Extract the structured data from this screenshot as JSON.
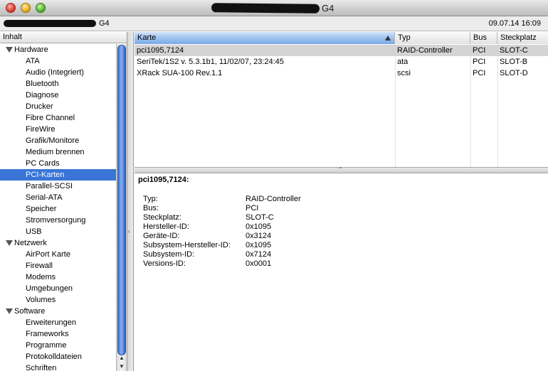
{
  "window": {
    "title_suffix": "G4"
  },
  "infobar": {
    "model": "G4",
    "datetime": "09.07.14 16:09"
  },
  "sidebar": {
    "header": "Inhalt",
    "groups": [
      {
        "label": "Hardware",
        "items": [
          "ATA",
          "Audio (Integriert)",
          "Bluetooth",
          "Diagnose",
          "Drucker",
          "Fibre Channel",
          "FireWire",
          "Grafik/Monitore",
          "Medium brennen",
          "PC Cards",
          "PCI-Karten",
          "Parallel-SCSI",
          "Serial-ATA",
          "Speicher",
          "Stromversorgung",
          "USB"
        ]
      },
      {
        "label": "Netzwerk",
        "items": [
          "AirPort Karte",
          "Firewall",
          "Modems",
          "Umgebungen",
          "Volumes"
        ]
      },
      {
        "label": "Software",
        "items": [
          "Erweiterungen",
          "Frameworks",
          "Programme",
          "Protokolldateien",
          "Schriften"
        ]
      }
    ],
    "selected_item": "PCI-Karten"
  },
  "table": {
    "columns": [
      "Karte",
      "Typ",
      "Bus",
      "Steckplatz"
    ],
    "sorted_column": "Karte",
    "rows": [
      {
        "karte": "pci1095,7124",
        "typ": "RAID-Controller",
        "bus": "PCI",
        "steckplatz": "SLOT-C"
      },
      {
        "karte": "SeriTek/1S2 v. 5.3.1b1, 11/02/07, 23:24:45",
        "typ": "ata",
        "bus": "PCI",
        "steckplatz": "SLOT-B"
      },
      {
        "karte": "XRack SUA-100 Rev.1.1",
        "typ": "scsi",
        "bus": "PCI",
        "steckplatz": "SLOT-D"
      }
    ],
    "selected_row": 0
  },
  "details": {
    "title": "pci1095,7124:",
    "rows": [
      {
        "label": "Typ:",
        "value": "RAID-Controller"
      },
      {
        "label": "Bus:",
        "value": "PCI"
      },
      {
        "label": "Steckplatz:",
        "value": "SLOT-C"
      },
      {
        "label": "Hersteller-ID:",
        "value": "0x1095"
      },
      {
        "label": "Geräte-ID:",
        "value": "0x3124"
      },
      {
        "label": "Subsystem-Hersteller-ID:",
        "value": "0x1095"
      },
      {
        "label": "Subsystem-ID:",
        "value": "0x7124"
      },
      {
        "label": "Versions-ID:",
        "value": "0x0001"
      }
    ]
  },
  "colors": {
    "selection": "#3875d7",
    "row_selected": "#d4d4d4"
  }
}
